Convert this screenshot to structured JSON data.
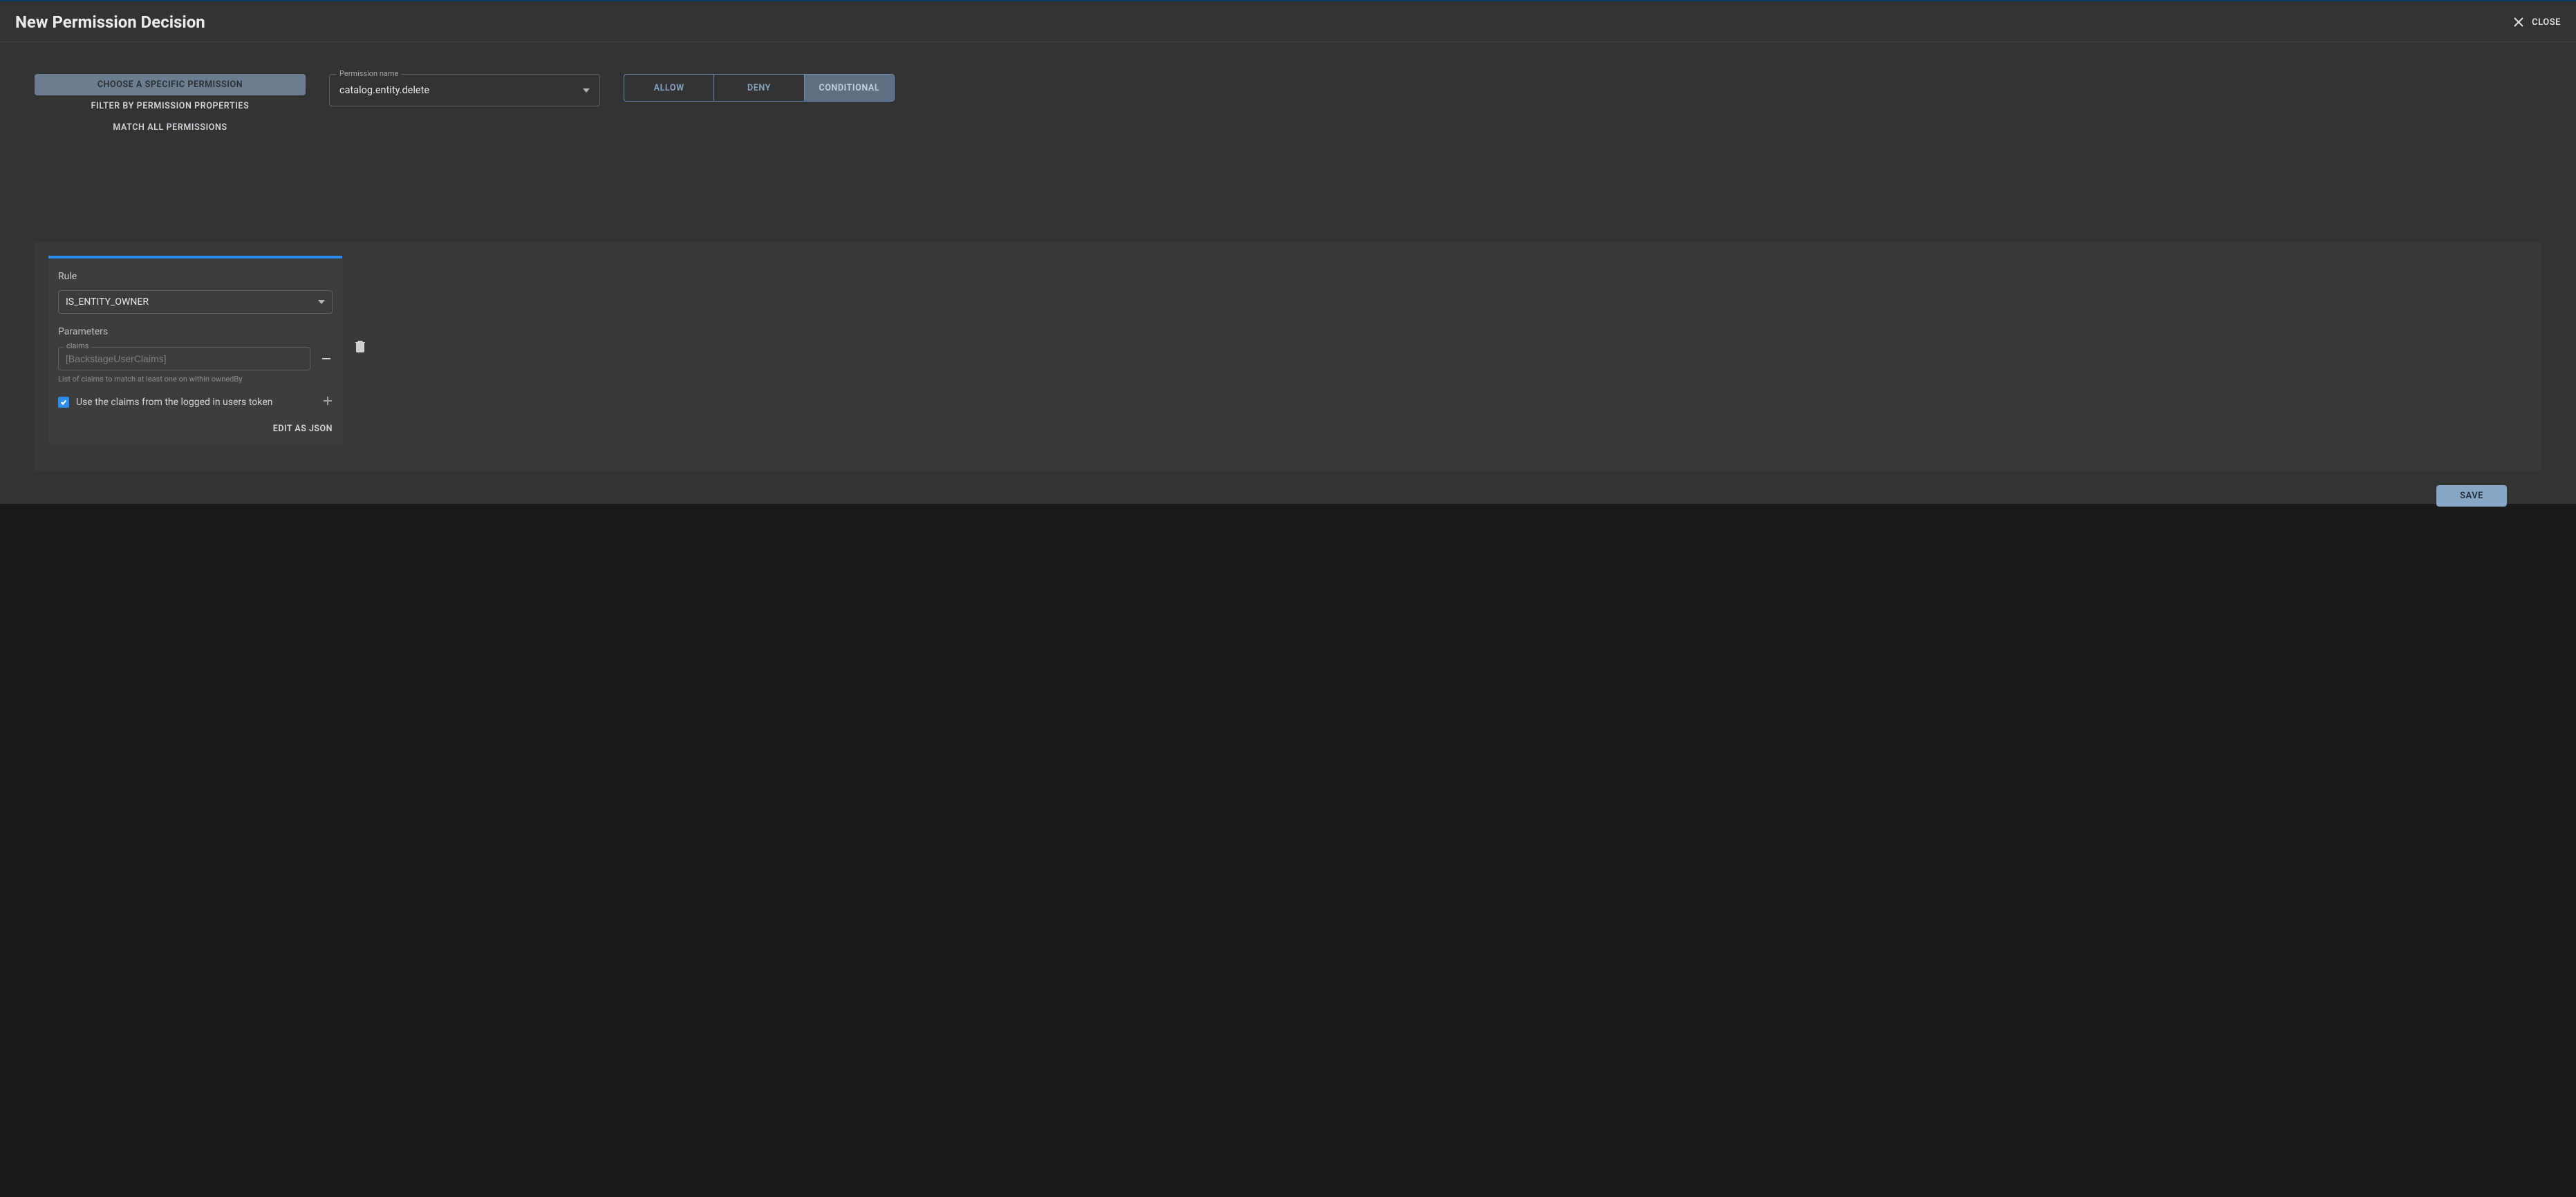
{
  "header": {
    "title": "New Permission Decision",
    "close_label": "CLOSE"
  },
  "match_modes": {
    "specific": "CHOOSE A SPECIFIC PERMISSION",
    "filter": "FILTER BY PERMISSION PROPERTIES",
    "all": "MATCH ALL PERMISSIONS"
  },
  "permission_select": {
    "label": "Permission name",
    "value": "catalog.entity.delete"
  },
  "decisions": {
    "allow": "ALLOW",
    "deny": "DENY",
    "conditional": "CONDITIONAL"
  },
  "rule": {
    "section_label": "Rule",
    "selected": "IS_ENTITY_OWNER",
    "parameters_label": "Parameters",
    "claims_field_label": "claims",
    "claims_placeholder": "[BackstageUserClaims]",
    "claims_helper": "List of claims to match at least one on within ownedBy",
    "use_logged_in_claims_label": "Use the claims from the logged in users token",
    "edit_as_json_label": "EDIT AS JSON"
  },
  "footer": {
    "save_label": "SAVE"
  }
}
